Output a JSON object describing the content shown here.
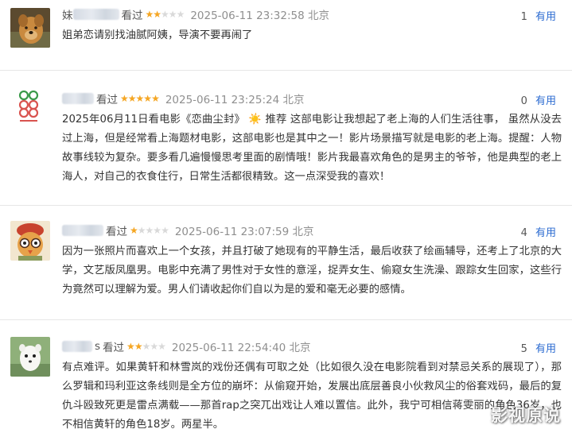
{
  "reviews": [
    {
      "author_visible": "妹",
      "watched": "看过",
      "rating": 2,
      "timestamp": "2025-06-11 23:32:58 北京",
      "useful_count": "1",
      "useful_label": "有用",
      "text": "姐弟恋请别找油腻阿姨，导演不要再闹了"
    },
    {
      "author_visible": "",
      "watched": "看过",
      "rating": 5,
      "timestamp": "2025-06-11 23:25:24 北京",
      "useful_count": "0",
      "useful_label": "有用",
      "text": "2025年06月11日看电影《恋曲尘封》 ☀️ 推荐 这部电影让我想起了老上海的人们生活往事， 虽然从没去过上海，但是经常看上海题材电影，这部电影也是其中之一！影片场景描写就是电影的老上海。提醒：人物故事线较为复杂。要多看几遍慢慢思考里面的剧情哦！影片我最喜欢角色的是男主的爷爷，他是典型的老上海人，对自己的衣食住行，日常生活都很精致。这一点深受我的喜欢！"
    },
    {
      "author_visible": "",
      "watched": "看过",
      "rating": 1,
      "timestamp": "2025-06-11 23:07:59 北京",
      "useful_count": "4",
      "useful_label": "有用",
      "text": "因为一张照片而喜欢上一个女孩，并且打破了她现有的平静生活，最后收获了绘画辅导，还考上了北京的大学，文艺版凤凰男。电影中充满了男性对于女性的意淫，捉弄女生、偷窥女生洗澡、跟踪女生回家，这些行为竟然可以理解为爱。男人们请收起你们自以为是的爱和毫无必要的感情。"
    },
    {
      "author_visible": "s",
      "watched": "看过",
      "rating": 2,
      "timestamp": "2025-06-11 22:54:40 北京",
      "useful_count": "5",
      "useful_label": "有用",
      "text": "有点难评。如果黄轩和林雪岚的戏份还偶有可取之处（比如很久没在电影院看到对禁忌关系的展现了），那么罗辑和玛利亚这条线则是全方位的崩坏：从偷窥开始，发展出底层善良小伙救风尘的俗套戏码，最后的复仇斗殴致死更是雷点满载——那首rap之突兀出戏让人难以置信。此外，我宁可相信蒋雯丽的角色36岁，也不相信黄轩的角色18岁。两星半。"
    }
  ],
  "colors": {
    "star_on": "#f5a623",
    "star_off": "#d9d9d9",
    "link": "#2b6bd1"
  },
  "avatars": [
    "dog-photo",
    "green-red-logo",
    "cartoon-bird",
    "white-ferret"
  ],
  "watermark": "影视原说"
}
